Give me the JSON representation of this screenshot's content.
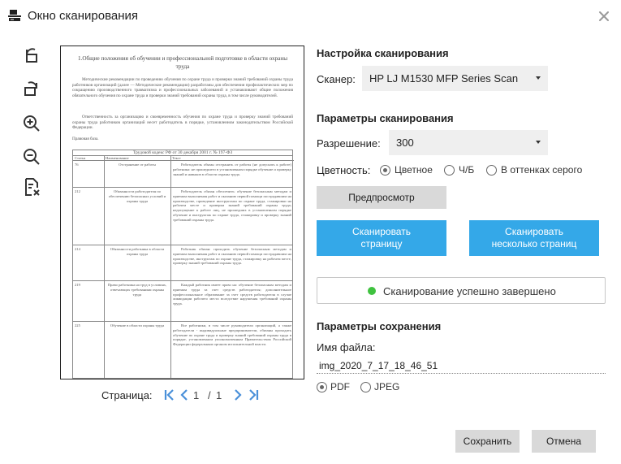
{
  "window": {
    "title": "Окно сканирования",
    "close_icon": "close-icon"
  },
  "toolbar": {
    "tools": [
      {
        "name": "rotate-left-icon"
      },
      {
        "name": "rotate-right-icon"
      },
      {
        "name": "zoom-in-icon"
      },
      {
        "name": "zoom-out-icon"
      },
      {
        "name": "delete-page-icon"
      }
    ]
  },
  "preview": {
    "doc_title": "1.Общие положения об обучении и профессиональной подготовке в области охраны труда",
    "para1": "Методические рекомендации по проведению обучения по охране труда и проверки знаний требований охраны труда работников организаций (далее — Методические рекомендации) разработаны для обеспечения профилактических мер по сокращению производственного травматизма и профессиональных заболеваний и устанавливают общие положения обязательного обучения по охране труда и проверки знаний требований охраны труда, в том числе руководителей.",
    "para2": "Ответственность за организацию и своевременность обучения по охране труда и проверку знаний требований охраны труда работников организаций несет работодатель в порядке, установленном законодательством Российской Федерации.",
    "para3": "Правовая база.",
    "table": {
      "header": "Трудовой кодекс РФ от 30 декабря 2001 г. № 197-ФЗ",
      "col1": "Статья",
      "col2": "Наименование",
      "col3": "Текст",
      "rows": [
        {
          "num": "76",
          "name": "Отстранение от работы",
          "text": "Работодатель обязан отстранить от работы (не допускать к работе) работника: не прошедшего в установленном порядке обучение и проверку знаний и навыков в области охраны труда."
        },
        {
          "num": "212",
          "name": "Обязанности работодателя по обеспечению безопасных условий и охраны труда",
          "text": "Работодатель обязан обеспечить: обучение безопасным методам и приемам выполнения работ и оказанию первой помощи пострадавшим на производстве, проведение инструктажа по охране труда, стажировки на рабочем месте и проверки знаний требований охраны труда; недопущение к работе лиц, не прошедших в установленном порядке обучение и инструктаж по охране труда, стажировку и проверку знаний требований охраны труда."
        },
        {
          "num": "214",
          "name": "Обязанности работника в области охраны труда",
          "text": "Работник обязан: проходить обучение безопасным методам и приемам выполнения работ и оказанию первой помощи пострадавшим на производстве, инструктаж по охране труда, стажировку на рабочем месте, проверку знаний требований охраны труда."
        },
        {
          "num": "219",
          "name": "Право работника на труд в условиях, отвечающих требованиям охраны труда",
          "text": "Каждый работник имеет право на: обучение безопасным методам и приемам труда за счет средств работодателя; дополнительное профессиональное образование за счет средств работодателя в случае ликвидации рабочего места вследствие нарушения требований охраны труда."
        },
        {
          "num": "225",
          "name": "Обучение в области охраны труда",
          "text": "Все работники, в том числе руководители организаций, а также работодатели - индивидуальные предприниматели, обязаны проходить обучение по охране труда и проверку знаний требований охраны труда в порядке, установленном уполномоченным Правительством Российской Федерации федеральным органом исполнительной власти."
        }
      ]
    }
  },
  "pager": {
    "label": "Страница:",
    "current": "1",
    "separator": "/",
    "total": "1"
  },
  "scan_settings": {
    "heading": "Настройка сканирования",
    "scanner_label": "Сканер:",
    "scanner_value": "HP LJ M1530 MFP Series Scan"
  },
  "scan_params": {
    "heading": "Параметры сканирования",
    "resolution_label": "Разрешение:",
    "resolution_value": "300",
    "color_label": "Цветность:",
    "color_options": [
      "Цветное",
      "Ч/Б",
      "В оттенках серого"
    ],
    "color_selected": 0
  },
  "buttons": {
    "preview": "Предпросмотр",
    "scan_page_line1": "Сканировать",
    "scan_page_line2": "страницу",
    "scan_multi_line1": "Сканировать",
    "scan_multi_line2": "несколько страниц",
    "save": "Сохранить",
    "cancel": "Отмена"
  },
  "status": {
    "text": "Сканирование успешно завершено",
    "color": "#3fc23f"
  },
  "save_params": {
    "heading": "Параметры сохранения",
    "filename_label": "Имя файла:",
    "filename_value": "img_2020_7_17_18_46_51",
    "format_options": [
      "PDF",
      "JPEG"
    ],
    "format_selected": 0
  },
  "colors": {
    "accent": "#34a8e8",
    "button_gray": "#d9d9d9",
    "select_bg": "#efefef"
  }
}
